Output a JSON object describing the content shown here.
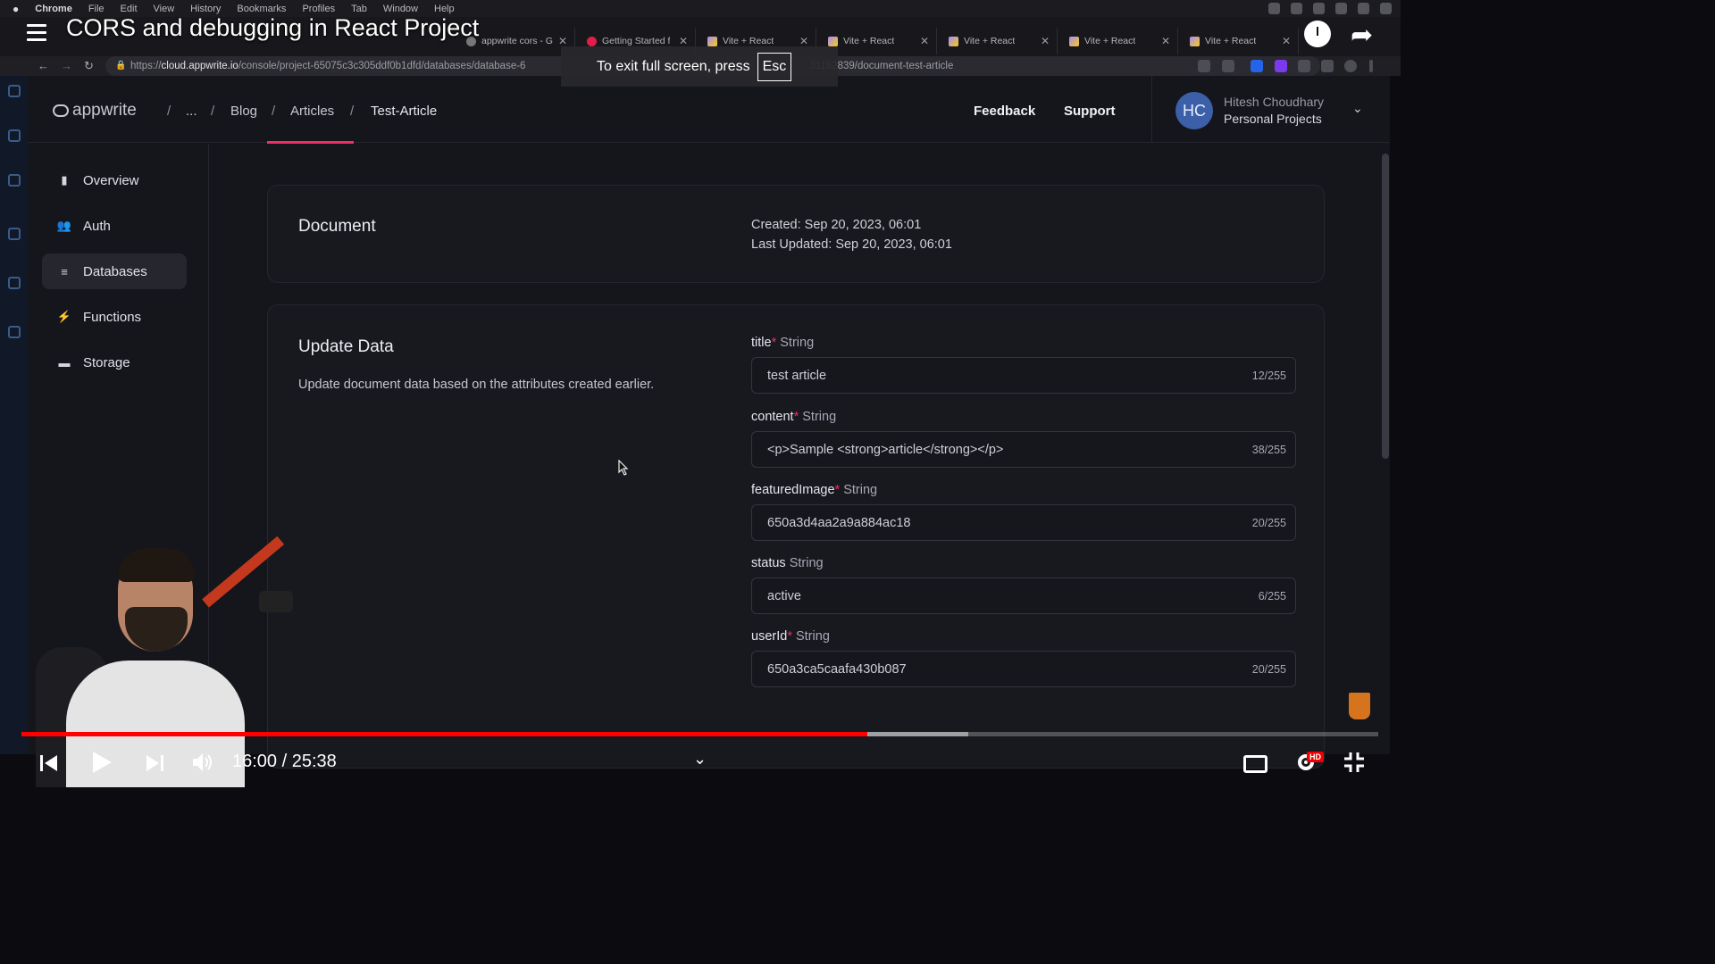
{
  "menubar": {
    "items": [
      "Chrome",
      "File",
      "Edit",
      "View",
      "History",
      "Bookmarks",
      "Profiles",
      "Tab",
      "Window",
      "Help"
    ]
  },
  "tabs": [
    {
      "label": "appwrite cors - G",
      "favicon": "google-icon"
    },
    {
      "label": "Getting Started f",
      "favicon": "appwrite-icon"
    },
    {
      "label": "Vite + React",
      "favicon": "vite-icon"
    },
    {
      "label": "Vite + React",
      "favicon": "vite-icon"
    },
    {
      "label": "Vite + React",
      "favicon": "vite-icon"
    },
    {
      "label": "Vite + React",
      "favicon": "vite-icon"
    },
    {
      "label": "Vite + React",
      "favicon": "vite-icon"
    }
  ],
  "address": {
    "prefix": "https://",
    "host": "cloud.appwrite.io",
    "path": "/console/project-65075c3c305ddf0b1dfd/databases/database-6",
    "tail": "31162839/document-test-article"
  },
  "video": {
    "title": "CORS and debugging in React Project",
    "fullscreen_hint": "To exit full screen, press",
    "fullscreen_key": "Esc",
    "time": "16:00 / 25:38",
    "progress_fraction": 0.6237,
    "buffered_fraction": 0.6979,
    "hd_badge": "HD"
  },
  "app": {
    "logo": "appwrite",
    "breadcrumbs": [
      "...",
      "Blog",
      "Articles",
      "Test-Article"
    ],
    "header_links": {
      "feedback": "Feedback",
      "support": "Support"
    },
    "user": {
      "initials": "HC",
      "name": "Hitesh Choudhary",
      "org": "Personal Projects"
    },
    "sidebar": [
      {
        "label": "Overview",
        "icon": "bar-chart-icon"
      },
      {
        "label": "Auth",
        "icon": "users-icon"
      },
      {
        "label": "Databases",
        "icon": "database-icon",
        "active": true
      },
      {
        "label": "Functions",
        "icon": "lightning-icon"
      },
      {
        "label": "Storage",
        "icon": "folder-icon"
      }
    ],
    "document_card": {
      "title": "Document",
      "created": "Created: Sep 20, 2023, 06:01",
      "updated": "Last Updated: Sep 20, 2023, 06:01"
    },
    "update_card": {
      "title": "Update Data",
      "description": "Update document data based on the attributes created earlier.",
      "fields": [
        {
          "name": "title",
          "required": true,
          "type": "String",
          "value": "test article",
          "count": "12/255"
        },
        {
          "name": "content",
          "required": true,
          "type": "String",
          "value": "<p>Sample <strong>article</strong></p>",
          "count": "38/255"
        },
        {
          "name": "featuredImage",
          "required": true,
          "type": "String",
          "value": "650a3d4aa2a9a884ac18",
          "count": "20/255"
        },
        {
          "name": "status",
          "required": false,
          "type": "String",
          "value": "active",
          "count": "6/255"
        },
        {
          "name": "userId",
          "required": true,
          "type": "String",
          "value": "650a3ca5caafa430b087",
          "count": "20/255"
        }
      ]
    }
  },
  "colors": {
    "accent": "#f02e65",
    "avatar": "#3b5fa8",
    "progress": "#ff0000"
  }
}
